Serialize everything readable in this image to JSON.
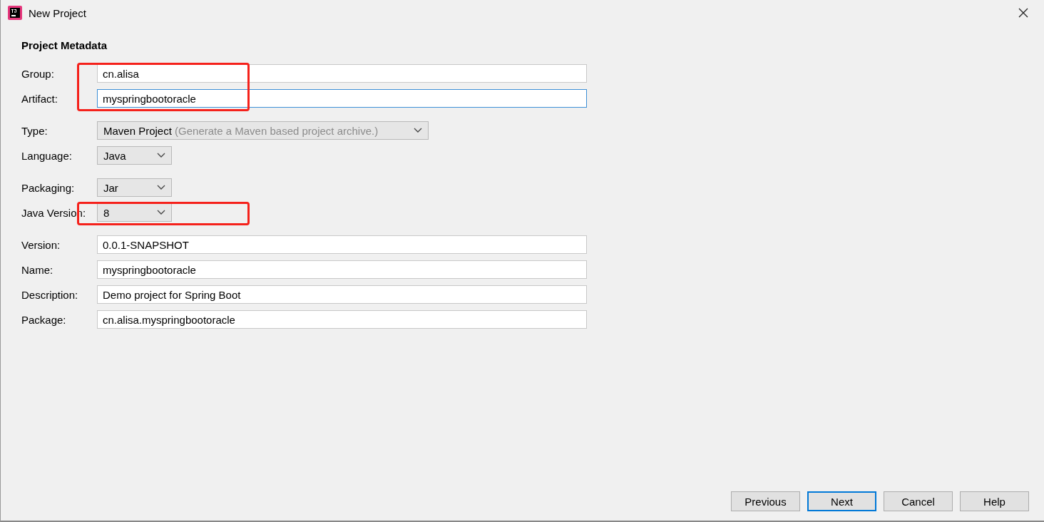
{
  "window": {
    "title": "New Project"
  },
  "heading": "Project Metadata",
  "sections": [
    [
      {
        "label": "Group:",
        "kind": "text",
        "value": "cn.alisa",
        "focused": false,
        "highlighted": true
      },
      {
        "label": "Artifact:",
        "kind": "text",
        "value": "myspringbootoracle",
        "focused": true,
        "highlighted": true
      }
    ],
    [
      {
        "label": "Type:",
        "kind": "combo",
        "value": "Maven Project",
        "hint": "(Generate a Maven based project archive.)",
        "highlighted": false
      },
      {
        "label": "Language:",
        "kind": "combo",
        "value": "Java",
        "highlighted": false
      }
    ],
    [
      {
        "label": "Packaging:",
        "kind": "combo",
        "value": "Jar",
        "highlighted": false
      },
      {
        "label": "Java Version:",
        "kind": "combo",
        "value": "8",
        "highlighted": true
      }
    ],
    [
      {
        "label": "Version:",
        "kind": "text",
        "value": "0.0.1-SNAPSHOT",
        "focused": false,
        "highlighted": false
      },
      {
        "label": "Name:",
        "kind": "text",
        "value": "myspringbootoracle",
        "focused": false,
        "highlighted": false
      },
      {
        "label": "Description:",
        "kind": "text",
        "value": "Demo project for Spring Boot",
        "focused": false,
        "highlighted": false
      },
      {
        "label": "Package:",
        "kind": "text",
        "value": "cn.alisa.myspringbootoracle",
        "focused": false,
        "highlighted": false
      }
    ]
  ],
  "buttons": [
    {
      "label": "Previous",
      "default": false
    },
    {
      "label": "Next",
      "default": true
    },
    {
      "label": "Cancel",
      "default": false
    },
    {
      "label": "Help",
      "default": false
    }
  ]
}
